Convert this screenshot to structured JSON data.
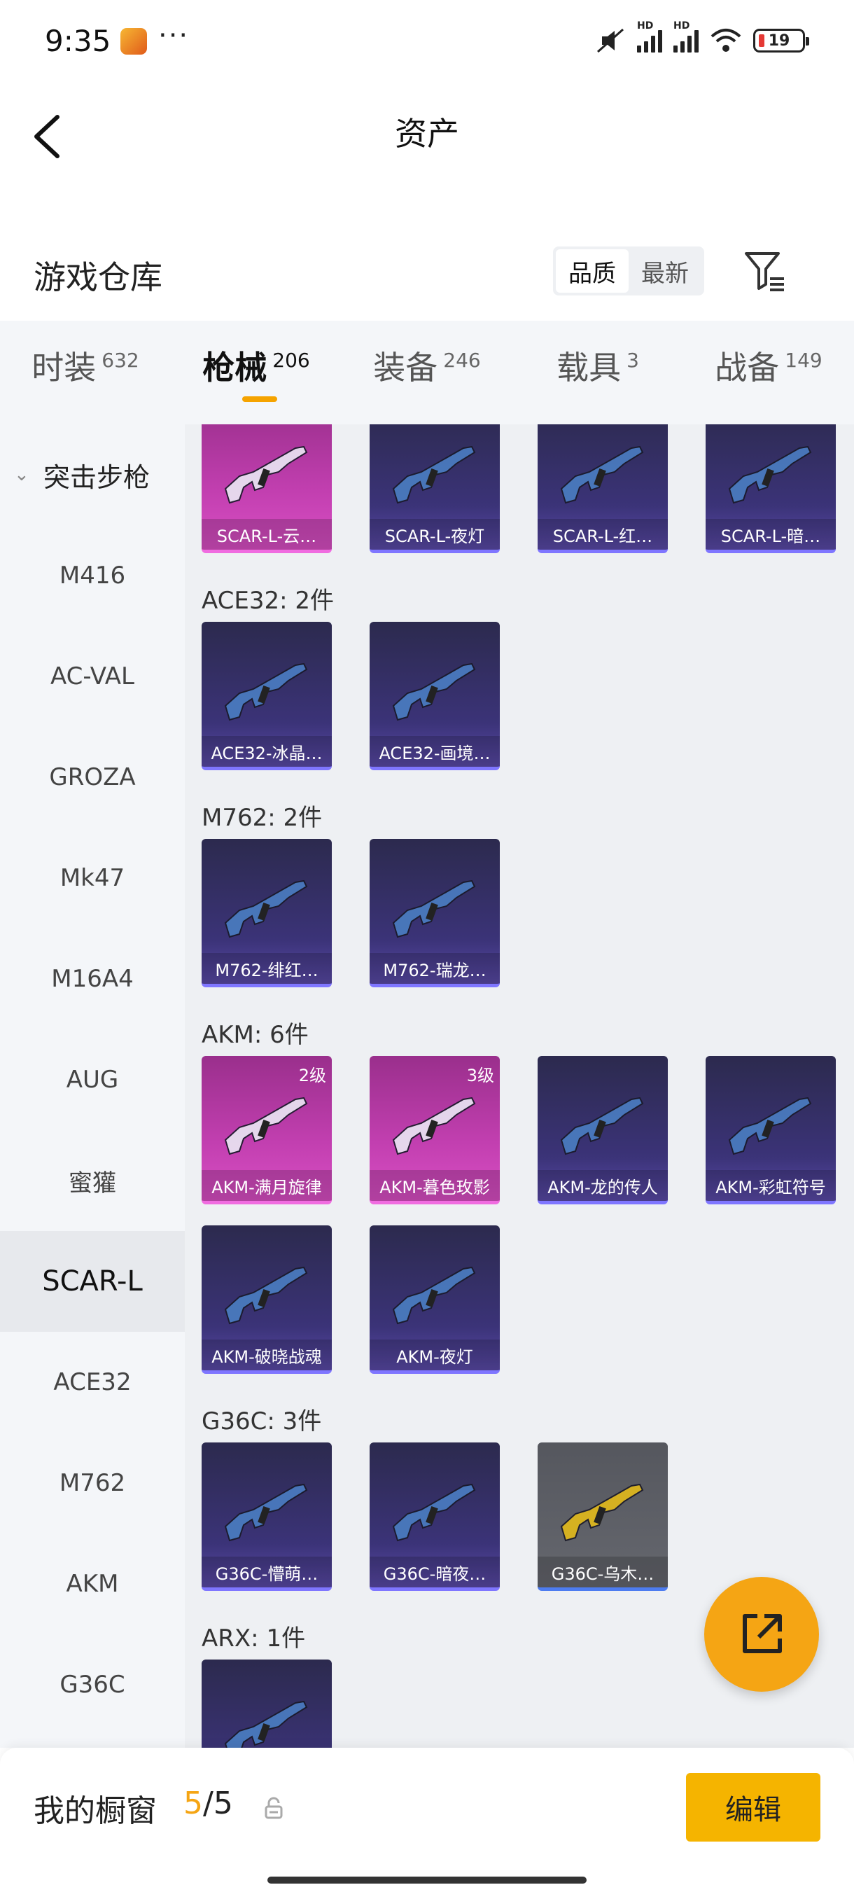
{
  "status_bar": {
    "time": "9:35",
    "dots": "···",
    "battery": "19",
    "signal_label": "HD"
  },
  "header": {
    "title": "资产"
  },
  "section": {
    "title": "游戏仓库",
    "sort_options": [
      "品质",
      "最新"
    ]
  },
  "tabs": [
    {
      "label": "时装",
      "count": "632"
    },
    {
      "label": "枪械",
      "count": "206",
      "active": true
    },
    {
      "label": "装备",
      "count": "246"
    },
    {
      "label": "载具",
      "count": "3"
    },
    {
      "label": "战备",
      "count": "149"
    }
  ],
  "sidebar": {
    "category": "突击步枪",
    "items": [
      "M416",
      "AC-VAL",
      "GROZA",
      "Mk47",
      "M16A4",
      "AUG",
      "蜜獾",
      "SCAR-L",
      "ACE32",
      "M762",
      "AKM",
      "G36C"
    ],
    "active_item": "SCAR-L"
  },
  "groups": {
    "scar": {
      "items": [
        {
          "name": "SCAR-L-云…",
          "rarity": "legend"
        },
        {
          "name": "SCAR-L-夜灯",
          "rarity": "epic"
        },
        {
          "name": "SCAR-L-红…",
          "rarity": "epic"
        },
        {
          "name": "SCAR-L-暗…",
          "rarity": "epic"
        }
      ]
    },
    "ace32": {
      "title": "ACE32: 2件",
      "items": [
        {
          "name": "ACE32-冰晶…",
          "rarity": "epic"
        },
        {
          "name": "ACE32-画境…",
          "rarity": "epic"
        }
      ]
    },
    "m762": {
      "title": "M762: 2件",
      "items": [
        {
          "name": "M762-绯红…",
          "rarity": "epic"
        },
        {
          "name": "M762-瑞龙…",
          "rarity": "epic"
        }
      ]
    },
    "akm": {
      "title": "AKM: 6件",
      "items": [
        {
          "name": "AKM-满月旋律",
          "rarity": "legend",
          "level": "2级"
        },
        {
          "name": "AKM-暮色玫影",
          "rarity": "legend",
          "level": "3级"
        },
        {
          "name": "AKM-龙的传人",
          "rarity": "epic"
        },
        {
          "name": "AKM-彩虹符号",
          "rarity": "epic"
        },
        {
          "name": "AKM-破晓战魂",
          "rarity": "epic"
        },
        {
          "name": "AKM-夜灯",
          "rarity": "epic"
        }
      ]
    },
    "g36c": {
      "title": "G36C: 3件",
      "items": [
        {
          "name": "G36C-懵萌…",
          "rarity": "epic"
        },
        {
          "name": "G36C-暗夜…",
          "rarity": "epic"
        },
        {
          "name": "G36C-乌木…",
          "rarity": "rare"
        }
      ]
    },
    "arx": {
      "title": "ARX: 1件",
      "items": [
        {
          "name": "",
          "rarity": "epic"
        }
      ]
    }
  },
  "bottom": {
    "label": "我的橱窗",
    "count_used": "5",
    "count_sep": "/",
    "count_total": "5",
    "edit_label": "编辑"
  },
  "colors": {
    "accent": "#f5a514",
    "legend": "#c23fb0",
    "epic": "#3b3378",
    "rare": "#65676e"
  }
}
